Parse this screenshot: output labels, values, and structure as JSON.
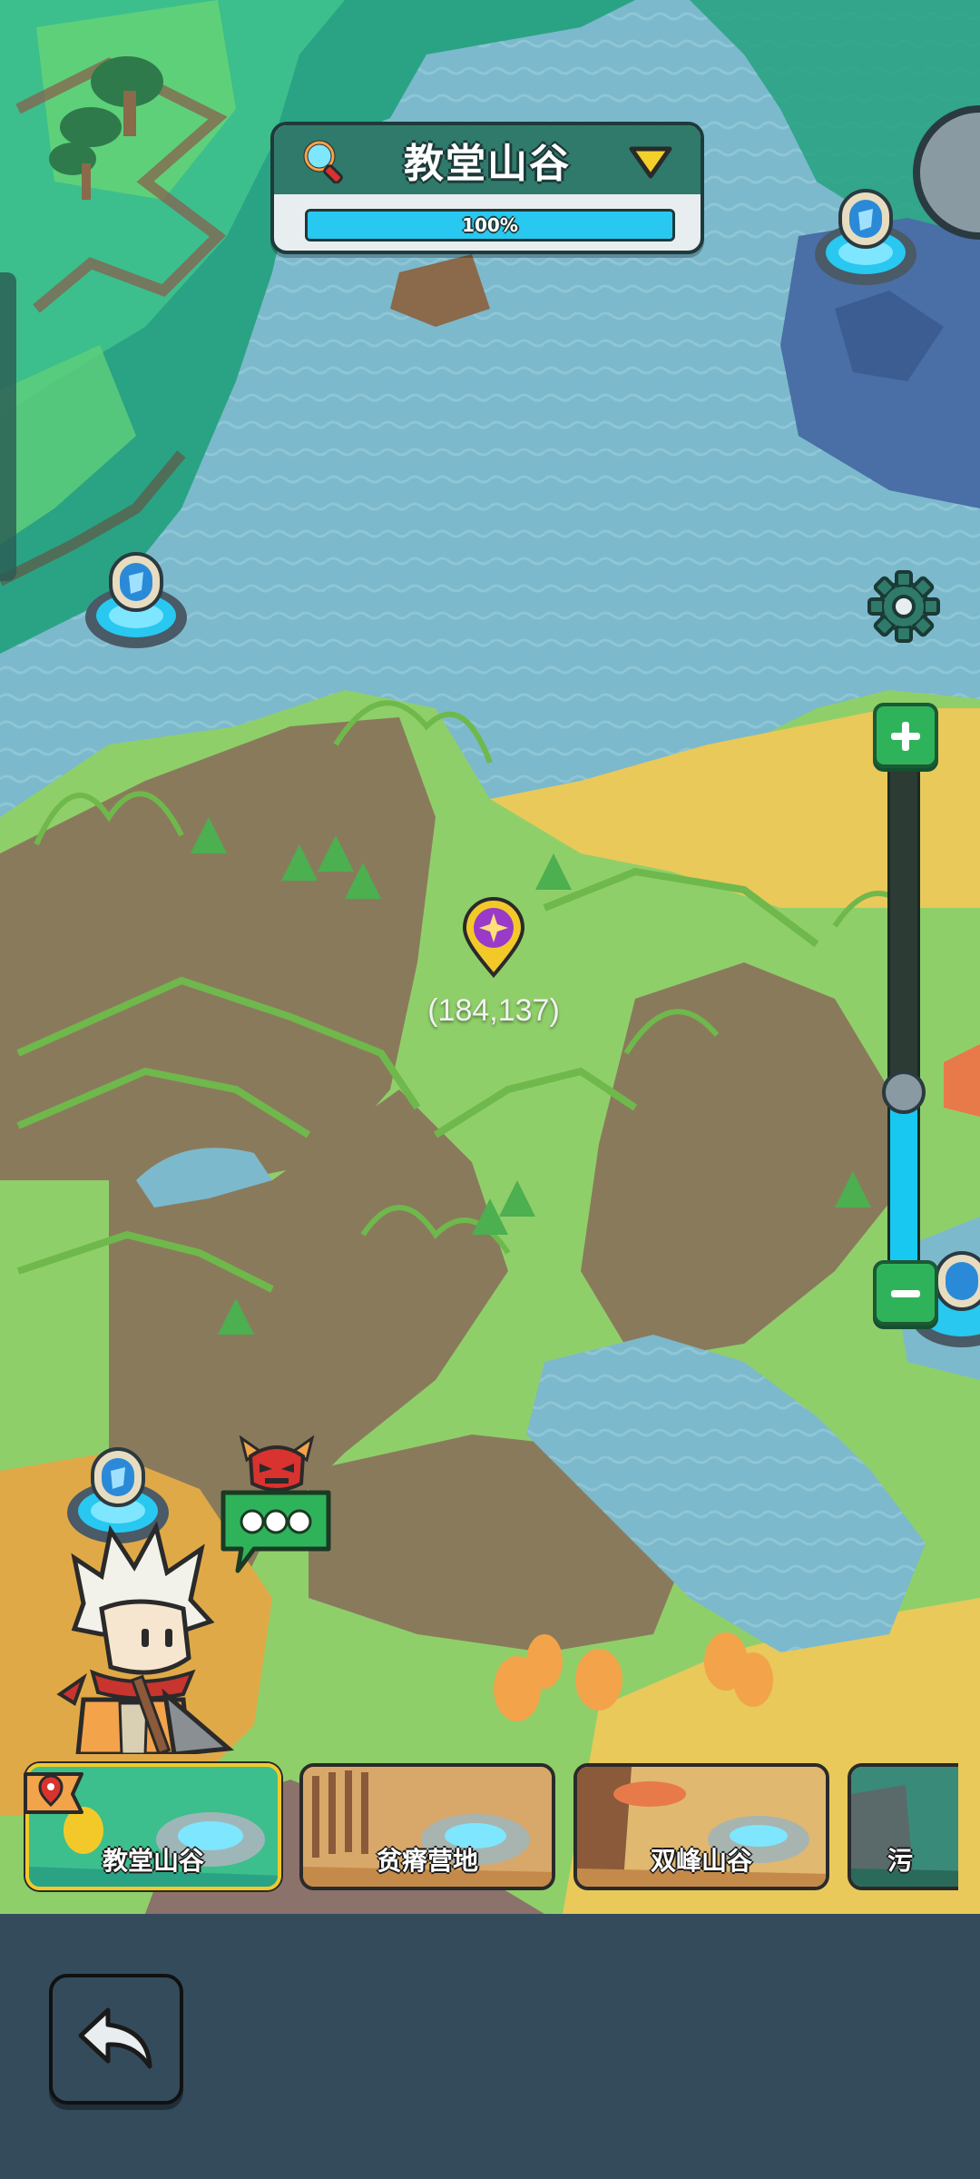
{
  "header": {
    "region_title": "教堂山谷",
    "progress_value": 1.0,
    "progress_text": "100%"
  },
  "map": {
    "coordinate_label": "(184,137)"
  },
  "zoom": {
    "level": 0.35
  },
  "regions": [
    {
      "name": "教堂山谷",
      "selected": true
    },
    {
      "name": "贫瘠营地",
      "selected": false
    },
    {
      "name": "双峰山谷",
      "selected": false
    },
    {
      "name": "污",
      "selected": false
    }
  ],
  "icons": {
    "search": "search-icon",
    "dropdown": "chevron-down-icon",
    "settings": "gear-icon",
    "zoom_in": "plus-icon",
    "zoom_out": "minus-icon",
    "back": "back-arrow-icon",
    "pin": "location-pin-icon",
    "chat": "speech-bubble-icon",
    "enemy": "demon-icon",
    "portal": "teleport-portal-icon"
  },
  "colors": {
    "water": "#7cb9cc",
    "grass": "#8fcf6a",
    "dirt": "#8a7a5c",
    "sand": "#e8c95a",
    "accent_green": "#2fb35a",
    "accent_cyan": "#28c8f0",
    "header_teal": "#2f7a6b",
    "selected_card": "#f3c92a",
    "bottom_panel": "#344b5c"
  }
}
